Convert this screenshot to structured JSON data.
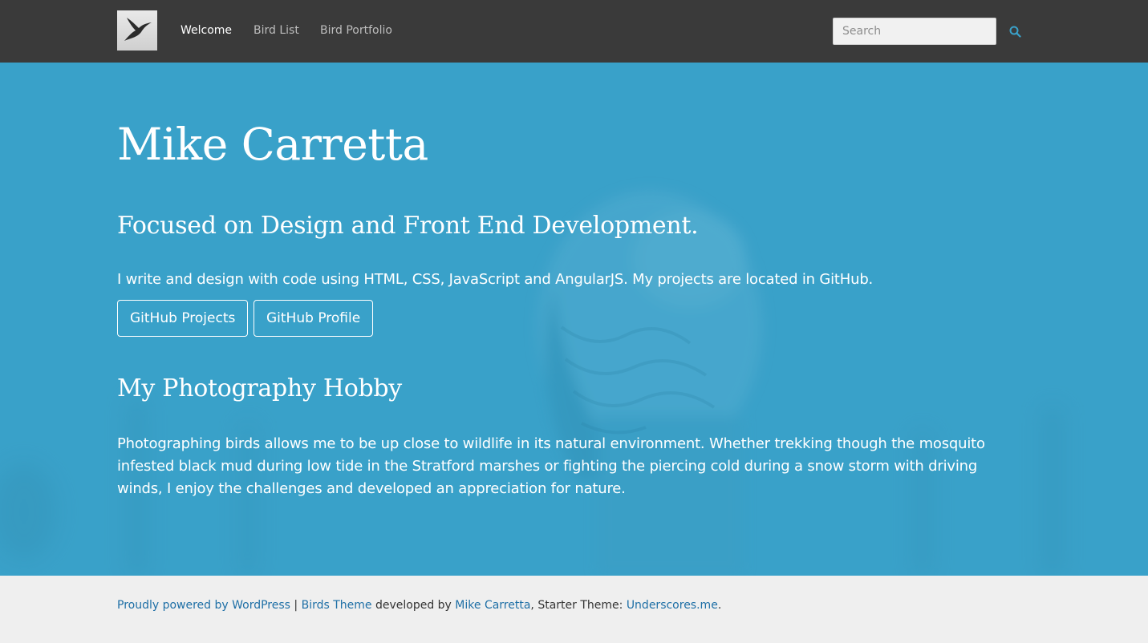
{
  "nav": {
    "logo_icon": "bird-logo-icon",
    "links": [
      {
        "label": "Welcome",
        "active": true
      },
      {
        "label": "Bird List",
        "active": false
      },
      {
        "label": "Bird Portfolio",
        "active": false
      }
    ],
    "search_placeholder": "Search",
    "search_icon": "search-icon"
  },
  "hero": {
    "title": "Mike Carretta",
    "subtitle": "Focused on Design and Front End Development.",
    "intro": "I write and design with code using HTML, CSS, JavaScript and AngularJS. My projects are located in GitHub.",
    "buttons": [
      {
        "label": "GitHub Projects"
      },
      {
        "label": "GitHub Profile"
      }
    ],
    "section_title": "My Photography Hobby",
    "section_body": "Photographing birds allows me to be up close to wildlife in its natural environment. Whether trekking though the mosquito infested black mud during low tide in the Stratford marshes or fighting the piercing cold during a snow storm with driving winds, I enjoy the challenges and developed an appreciation for nature."
  },
  "footer": {
    "powered_link": "Proudly powered by WordPress",
    "separator": " | ",
    "theme_link": "Birds Theme",
    "developed_by": " developed by ",
    "author_link": "Mike Carretta",
    "starter_text": ", Starter Theme: ",
    "underscores_link": "Underscores.me",
    "end": "."
  },
  "colors": {
    "nav_bg": "#3a3a3a",
    "hero_bg": "#3aa1c9",
    "link": "#1e6fa6",
    "search_icon": "#3aa1c9"
  }
}
